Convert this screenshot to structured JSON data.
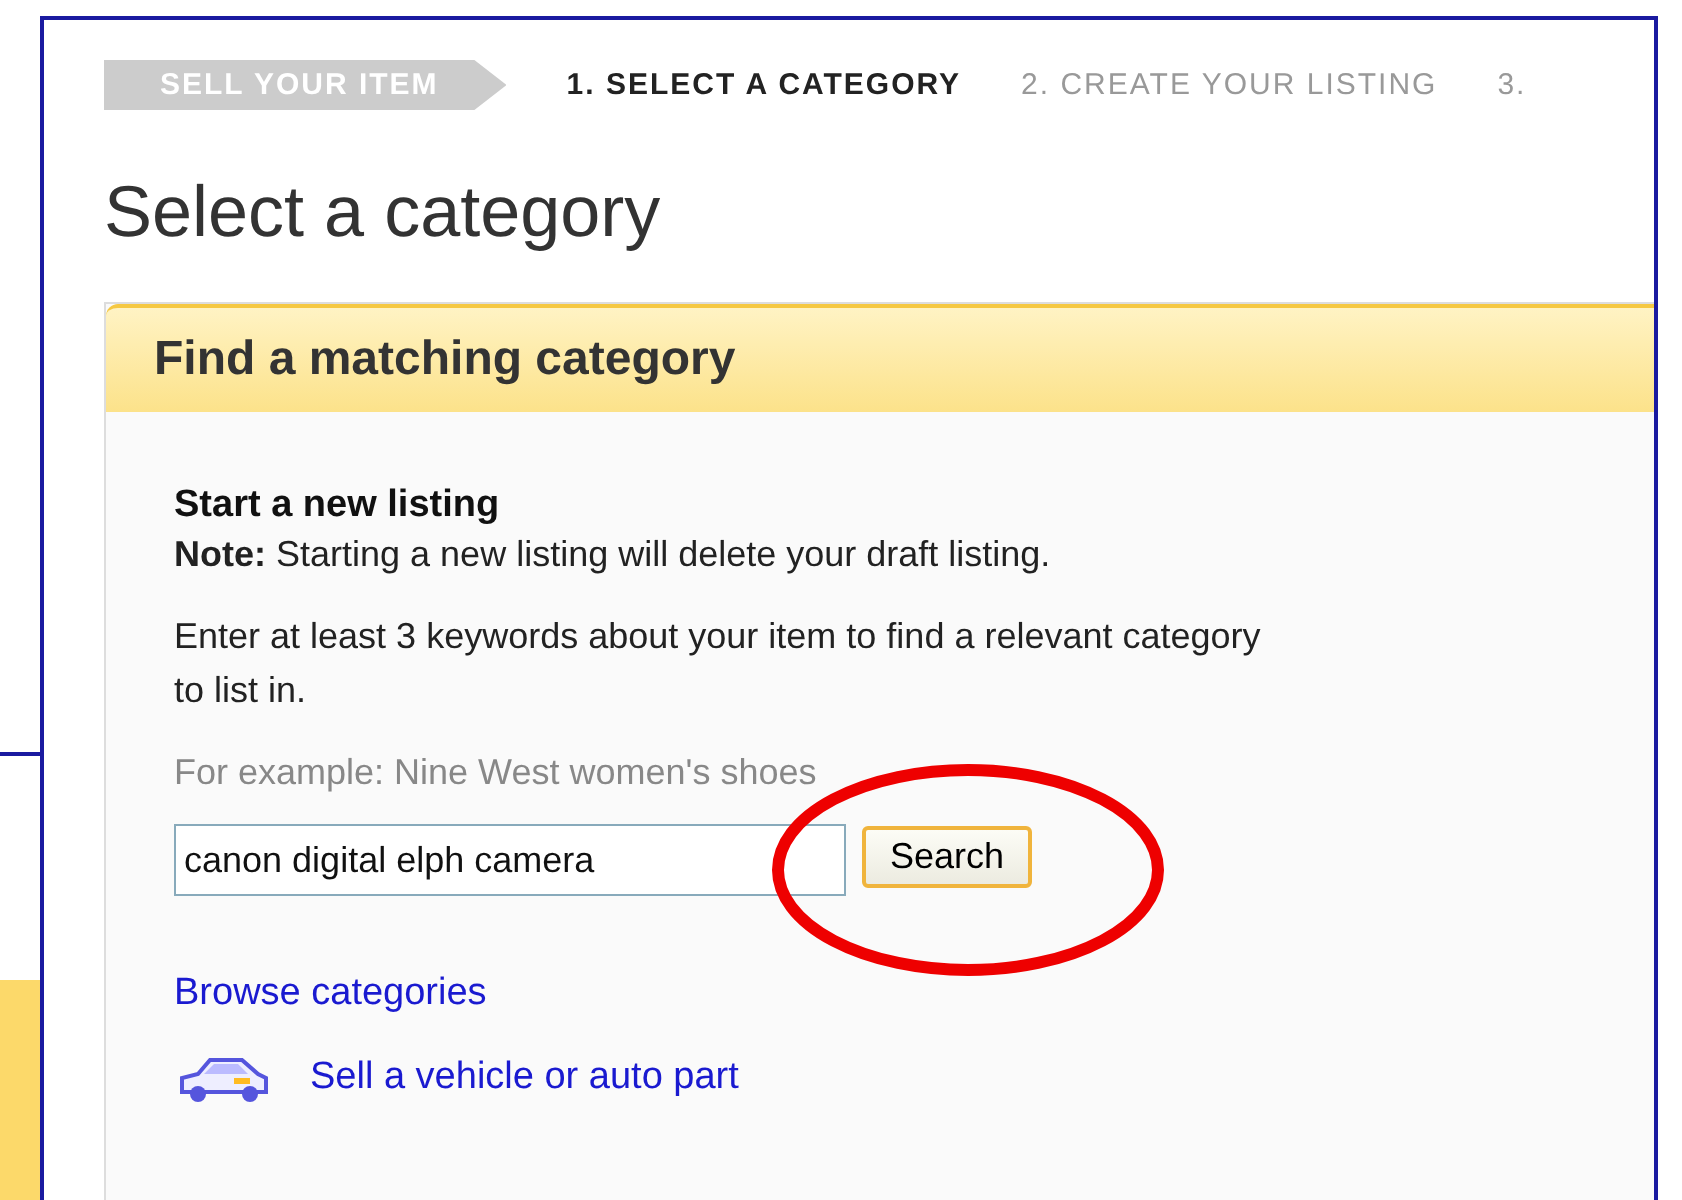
{
  "breadcrumb": {
    "badge": "SELL YOUR ITEM",
    "steps": [
      {
        "label": "1. SELECT A CATEGORY",
        "selected": true
      },
      {
        "label": "2. CREATE YOUR LISTING",
        "selected": false
      },
      {
        "label": "3.",
        "selected": false
      }
    ]
  },
  "heading": "Select a category",
  "panel": {
    "title": "Find a matching category",
    "section_title": "Start a new listing",
    "note": "**Note:** Starting a new listing will delete your draft listing.",
    "instructions": "Enter at least 3 keywords about your item to find a relevant category to list in.",
    "example": "For example: Nine West women's shoes",
    "search": {
      "value": "canon digital elph camera",
      "button": "Search"
    },
    "links": [
      {
        "kind": "text",
        "label": "Browse categories"
      },
      {
        "kind": "vehicle",
        "label": "Sell a vehicle or auto part"
      }
    ]
  }
}
